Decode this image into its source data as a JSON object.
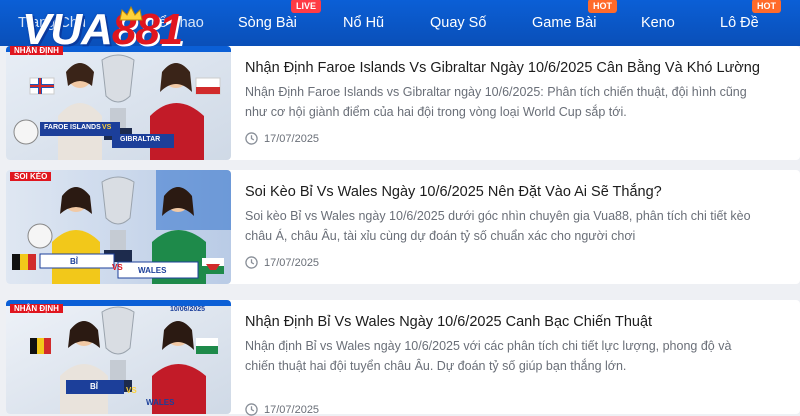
{
  "header": {
    "logo_text": "VUA",
    "logo_number": "88",
    "logo_number_tail": "1",
    "nav": [
      {
        "label": "Trang Chủ"
      },
      {
        "label": "Thể Thao"
      },
      {
        "label": "Sòng Bài",
        "badge": "LIVE"
      },
      {
        "label": "Nổ Hũ"
      },
      {
        "label": "Quay Số"
      },
      {
        "label": "Game Bài",
        "badge": "HOT"
      },
      {
        "label": "Keno"
      },
      {
        "label": "Lô Đề",
        "badge": "HOT"
      }
    ]
  },
  "articles": [
    {
      "title": "Nhận Định Faroe Islands Vs Gibraltar Ngày 10/6/2025 Cân Bằng Và Khó Lường",
      "excerpt": "Nhận Định Faroe Islands vs Gibraltar ngày 10/6/2025: Phân tích chiến thuật, đội hình cũng như cơ hội giành điểm của hai đội trong vòng loại World Cup sắp tới.",
      "date": "17/07/2025",
      "thumb": {
        "tag": "NHẬN ĐỊNH",
        "team_a": "FAROE ISLANDS",
        "team_b": "GIBRALTAR",
        "vs": "VS"
      }
    },
    {
      "title": "Soi Kèo Bỉ Vs Wales Ngày 10/6/2025 Nên Đặt Vào Ai Sẽ Thắng?",
      "excerpt": "Soi kèo Bỉ vs Wales ngày 10/6/2025 dưới góc nhìn chuyên gia Vua88, phân tích chi tiết kèo châu Á, châu Âu, tài xỉu cùng dự đoán tỷ số chuẩn xác cho người chơi",
      "date": "17/07/2025",
      "thumb": {
        "tag": "SOI KÈO",
        "team_a": "BỈ",
        "team_b": "WALES",
        "vs": "VS"
      }
    },
    {
      "title": "Nhận Định Bỉ Vs Wales Ngày 10/6/2025 Canh Bạc Chiến Thuật",
      "excerpt": "Nhận định Bỉ vs Wales ngày 10/6/2025 với các phân tích chi tiết lực lượng, phong độ và chiến thuật hai đội tuyển châu Âu. Dự đoán tỷ số giúp bạn thắng lớn.",
      "date": "17/07/2025",
      "thumb": {
        "tag": "NHẬN ĐỊNH",
        "date_text": "10/06/2025",
        "team_a": "BỈ",
        "team_b": "WALES",
        "vs": "VS"
      }
    }
  ],
  "colors": {
    "nav_bg": "#0b5fd6",
    "live_badge": "#ff3b45",
    "hot_badge": "#ff6a2a",
    "logo_red": "#e0161f",
    "page_bg": "#eef0f4"
  }
}
